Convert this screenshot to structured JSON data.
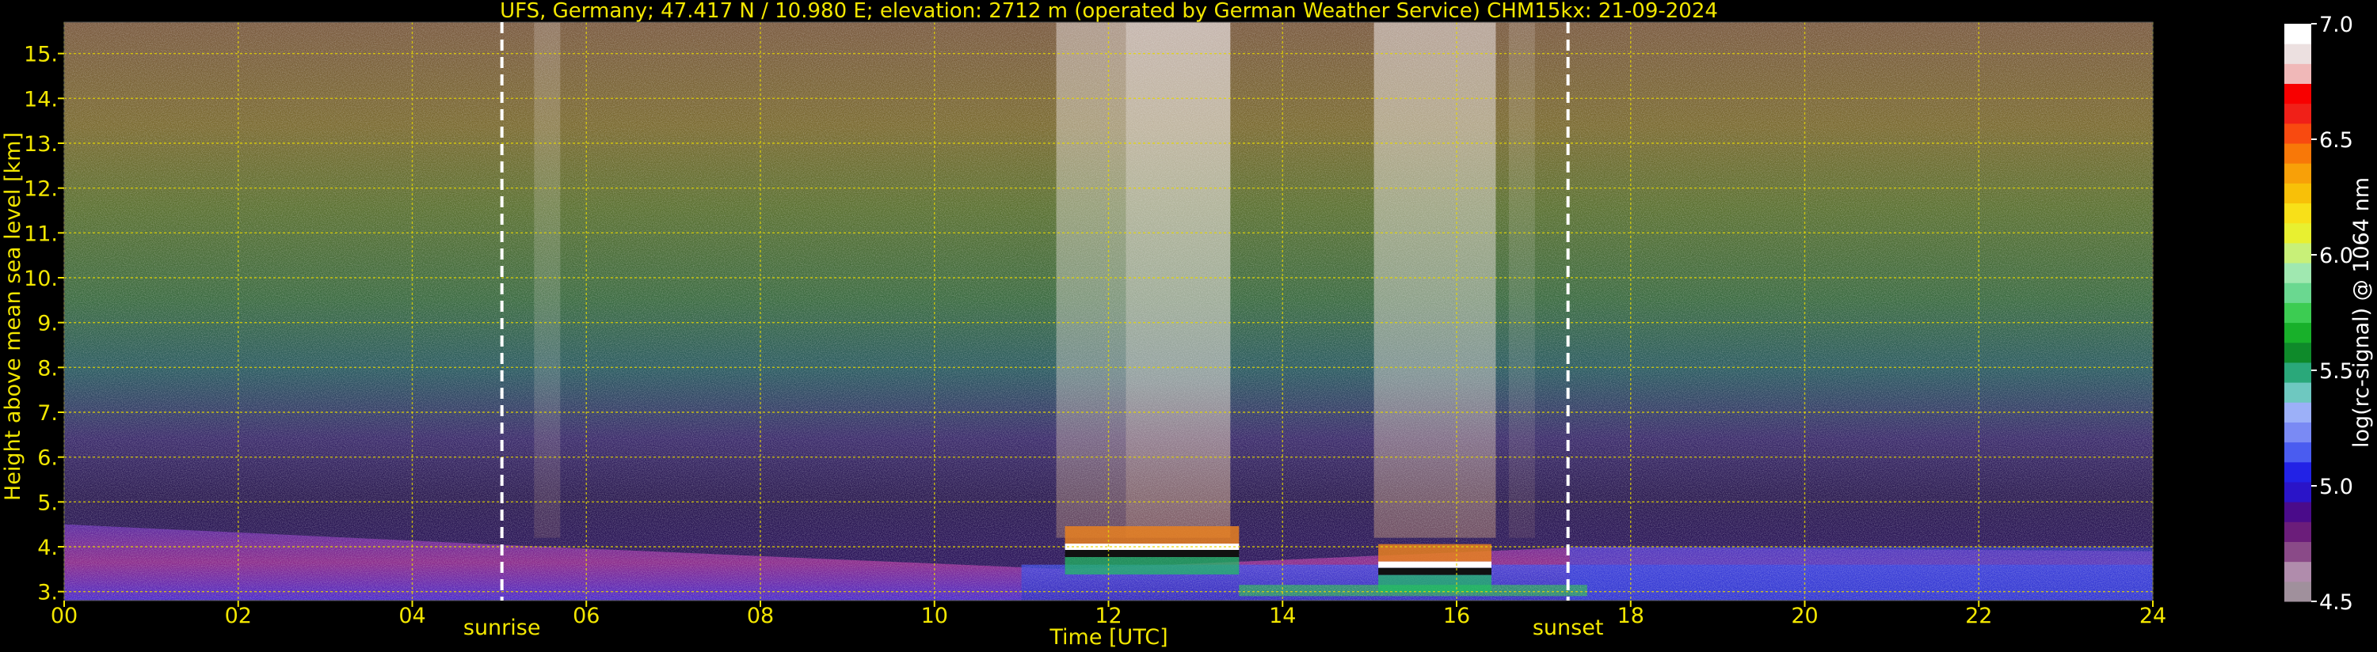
{
  "chart_data": {
    "type": "heatmap",
    "title": "UFS, Germany; 47.417 N / 10.980 E; elevation: 2712 m  (operated by German Weather Service)    CHM15kx: 21-09-2024",
    "xlabel": "Time [UTC]",
    "ylabel": "Height above mean sea level [km]",
    "colorbar_label": "log(rc-signal) @ 1064 nm",
    "xlim": [
      0,
      24
    ],
    "ylim": [
      2.8,
      15.7
    ],
    "x_ticks": [
      0,
      2,
      4,
      6,
      8,
      10,
      12,
      14,
      16,
      18,
      20,
      22,
      24
    ],
    "x_tick_labels": [
      "00",
      "02",
      "04",
      "06",
      "08",
      "10",
      "12",
      "14",
      "16",
      "18",
      "20",
      "22",
      "24"
    ],
    "y_ticks": [
      3,
      4,
      5,
      6,
      7,
      8,
      9,
      10,
      11,
      12,
      13,
      14,
      15
    ],
    "y_tick_labels": [
      "3.",
      "4.",
      "5.",
      "6.",
      "7.",
      "8.",
      "9.",
      "10.",
      "11.",
      "12.",
      "13.",
      "14.",
      "15."
    ],
    "grid": true,
    "colorbar_range": [
      4.5,
      7.0
    ],
    "colorbar_ticks": [
      4.5,
      5.0,
      5.5,
      6.0,
      6.5,
      7.0
    ],
    "colorbar_tick_labels": [
      "4.5",
      "5.0",
      "5.5",
      "6.0",
      "6.5",
      "7.0"
    ],
    "colorbar_colors": [
      "#a0909c",
      "#b08cac",
      "#8a4a88",
      "#6b1d7a",
      "#4a0b8a",
      "#2a14c8",
      "#2222e6",
      "#4a5cf0",
      "#7a8af4",
      "#9cb0f8",
      "#6ec8c0",
      "#2aa87a",
      "#0e8a2a",
      "#18b02a",
      "#3ccc52",
      "#6ad890",
      "#a0e8b0",
      "#c8f078",
      "#e8f030",
      "#f8e018",
      "#f8c008",
      "#f8a008",
      "#f87808",
      "#f84a10",
      "#f02018",
      "#f80000",
      "#f0b8b8",
      "#ece0e0",
      "#ffffff"
    ],
    "markers": [
      {
        "label": "sunrise",
        "x": 5.03
      },
      {
        "label": "sunset",
        "x": 17.28
      }
    ],
    "cloud_layers": [
      {
        "x_start": 11.5,
        "x_end": 13.5,
        "height": 4.0
      },
      {
        "x_start": 15.1,
        "x_end": 16.4,
        "height": 3.6
      }
    ],
    "boundary_layer_top": [
      {
        "x": 0,
        "y": 4.5
      },
      {
        "x": 5.5,
        "y": 4.0
      },
      {
        "x": 11.5,
        "y": 3.5
      },
      {
        "x": 17.5,
        "y": 4.0
      },
      {
        "x": 24,
        "y": 3.9
      }
    ]
  }
}
